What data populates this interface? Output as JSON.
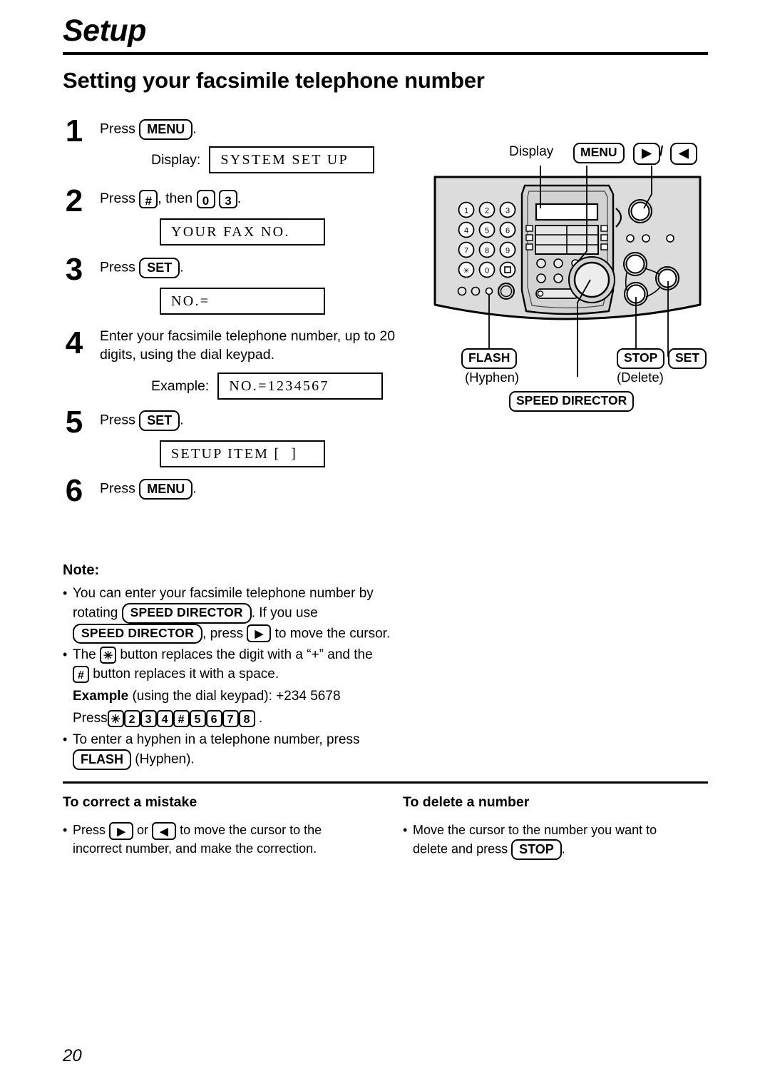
{
  "header": {
    "chapter": "Setup",
    "section_title": "Setting your facsimile telephone number"
  },
  "steps": [
    {
      "num": "1",
      "text_before": "Press",
      "key": "MENU",
      "text_after": ".",
      "display_label": "Display:",
      "display_value": "SYSTEM SET UP"
    },
    {
      "num": "2",
      "text_before": "Press",
      "keys": [
        "#",
        "0",
        "3"
      ],
      "text_mid": ", then",
      "text_after": ".",
      "display_label": "",
      "display_value": "YOUR FAX NO."
    },
    {
      "num": "3",
      "text_before": "Press",
      "key": "SET",
      "text_after": ".",
      "display_label": "",
      "display_value": "NO.="
    },
    {
      "num": "4",
      "text": "Enter your facsimile telephone number, up to 20 digits, using the dial keypad.",
      "display_label": "Example:",
      "display_value": "NO.=1234567"
    },
    {
      "num": "5",
      "text_before": "Press",
      "key": "SET",
      "text_after": ".",
      "display_label": "",
      "display_value": "SETUP ITEM [  ]"
    },
    {
      "num": "6",
      "text_before": "Press",
      "key": "MENU",
      "text_after": "."
    }
  ],
  "note": {
    "title": "Note:",
    "b1_part1": "You can enter your facsimile telephone number by",
    "b1_part2": "rotating",
    "b1_key1": "SPEED DIRECTOR",
    "b1_part3": ". If you use",
    "b1_key2": "SPEED DIRECTOR",
    "b1_part4": ", press",
    "b1_arrow": "▶",
    "b1_part5": "to move the cursor.",
    "b2_part1": "The",
    "b2_key1": "✳",
    "b2_part2": "button replaces the digit with a “+” and the",
    "b2_key2": "#",
    "b2_part3": "button replaces it with a space.",
    "example_label": "Example",
    "example_text": "(using the dial keypad):  +234  5678",
    "press_label": "Press",
    "press_keys": [
      "✳",
      "2",
      "3",
      "4",
      "#",
      "5",
      "6",
      "7",
      "8"
    ],
    "press_period": ".",
    "b3_part1": "To enter a hyphen in a telephone number, press",
    "b3_key": "FLASH",
    "b3_part2": "(Hyphen)."
  },
  "bottom": {
    "left": {
      "title": "To correct a mistake",
      "part1": "Press",
      "arrow_right": "▶",
      "or": "or",
      "arrow_left": "◀",
      "part2": "to move the cursor to the",
      "part3": "incorrect number, and make the correction."
    },
    "right": {
      "title": "To delete a number",
      "part1": "Move the cursor to the number you want to",
      "part2": "delete and press",
      "key": "STOP",
      "part3": "."
    }
  },
  "figure": {
    "display_label": "Display",
    "menu_label": "MENU",
    "arrow_right": "▶",
    "slash": "/",
    "arrow_left": "◀",
    "flash_label": "FLASH",
    "hyphen_label": "(Hyphen)",
    "speed_director_label": "SPEED DIRECTOR",
    "stop_label": "STOP",
    "delete_label": "(Delete)",
    "set_label": "SET",
    "keypad": [
      "1",
      "2",
      "3",
      "4",
      "5",
      "6",
      "7",
      "8",
      "9",
      "✳",
      "0",
      "■"
    ],
    "body_color": "#dcdcdc",
    "outline_color": "#000000"
  },
  "page_number": "20"
}
